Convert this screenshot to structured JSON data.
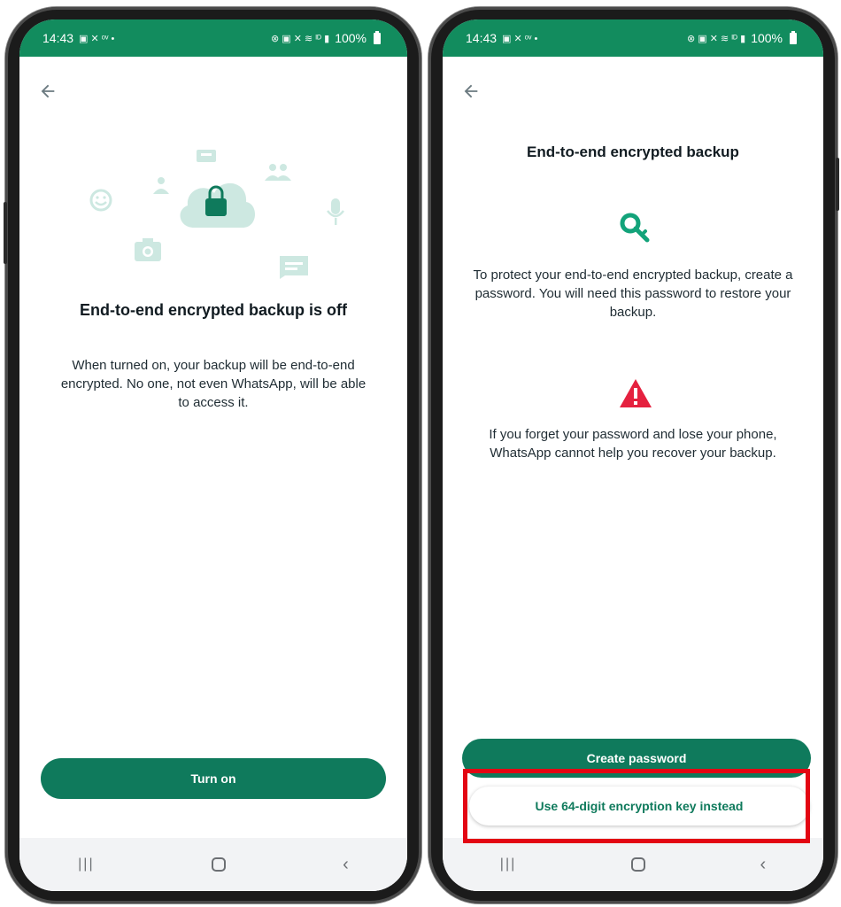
{
  "status_bar": {
    "time": "14:43",
    "left_icons": "▣ ✕ ᵒᵛ •",
    "right_icons": "⊗ ▣ ✕ ≋ ᴵᴰ ▮",
    "battery": "100%"
  },
  "left_screen": {
    "title": "End-to-end encrypted backup is off",
    "body": "When turned on, your backup will be end-to-end encrypted. No one, not even WhatsApp, will be able to access it.",
    "button_label": "Turn on"
  },
  "right_screen": {
    "title": "End-to-end encrypted backup",
    "info_text": "To protect your end-to-end encrypted backup, create a password. You will need this password to restore your backup.",
    "warning_text": "If you forget your password and lose your phone, WhatsApp cannot help you recover your backup.",
    "primary_button_label": "Create password",
    "secondary_button_label": "Use 64-digit encryption key instead"
  },
  "nav_bar": {
    "recents": "|||",
    "back": "‹"
  },
  "colors": {
    "status_bar": "#128c5e",
    "primary_button": "#0f7a5c",
    "key_icon": "#13a37a",
    "warning_icon": "#e5213f",
    "highlight": "#e30613",
    "illustration": "#cde8e1"
  }
}
